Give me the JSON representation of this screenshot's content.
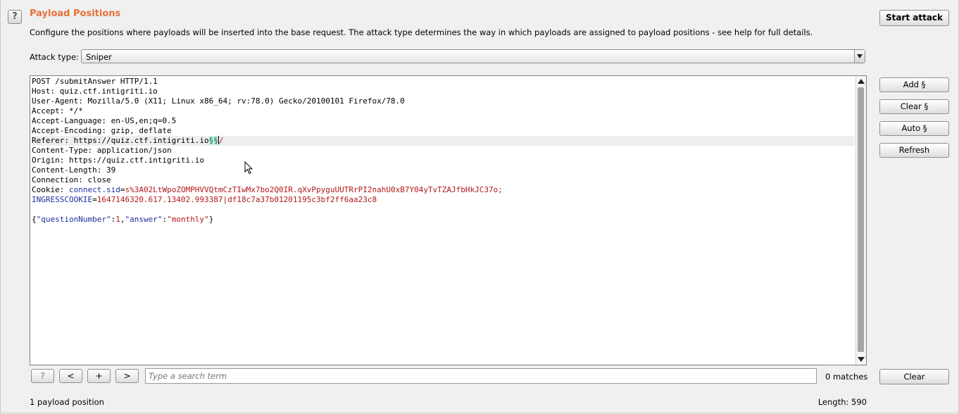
{
  "header": {
    "help_icon": "?",
    "title": "Payload Positions",
    "description": "Configure the positions where payloads will be inserted into the base request. The attack type determines the way in which payloads are assigned to payload positions - see help for full details.",
    "start_attack_label": "Start attack"
  },
  "attack_type": {
    "label": "Attack type:",
    "value": "Sniper"
  },
  "request": {
    "lines": [
      "POST /submitAnswer HTTP/1.1",
      "Host: quiz.ctf.intigriti.io",
      "User-Agent: Mozilla/5.0 (X11; Linux x86_64; rv:78.0) Gecko/20100101 Firefox/78.0",
      "Accept: */*",
      "Accept-Language: en-US,en;q=0.5",
      "Accept-Encoding: gzip, deflate"
    ],
    "referer_prefix": "Referer: https://quiz.ctf.intigriti.io",
    "payload_marker": "§§",
    "referer_suffix": "/",
    "lines_after": [
      "Content-Type: application/json",
      "Origin: https://quiz.ctf.intigriti.io",
      "Content-Length: 39",
      "Connection: close"
    ],
    "cookie_prefix": "Cookie: ",
    "cookie1_name": "connect.sid",
    "cookie1_value": "s%3A02LtWpoZOMPHVVQtmCzTIwMx7bo2Q0IR.qXvPpyguUUTRrPI2nahU0xB7Y04yTvTZAJfbHkJC37o;",
    "cookie2_name": "INGRESSCOOKIE",
    "cookie2_value": "1647146320.617.13402.993387|df18c7a37b01201195c3bf2ff6aa23c8",
    "body": {
      "open": "{",
      "key1": "\"questionNumber\"",
      "val1": "1",
      "key2": "\"answer\"",
      "val2": "\"monthly\"",
      "close": "}"
    }
  },
  "side_buttons": {
    "add": "Add §",
    "clear": "Clear §",
    "auto": "Auto §",
    "refresh": "Refresh"
  },
  "search_bar": {
    "help": "?",
    "prev": "<",
    "add": "+",
    "next": ">",
    "placeholder": "Type a search term",
    "matches": "0 matches",
    "clear": "Clear"
  },
  "footer": {
    "positions": "1 payload position",
    "length": "Length: 590"
  }
}
